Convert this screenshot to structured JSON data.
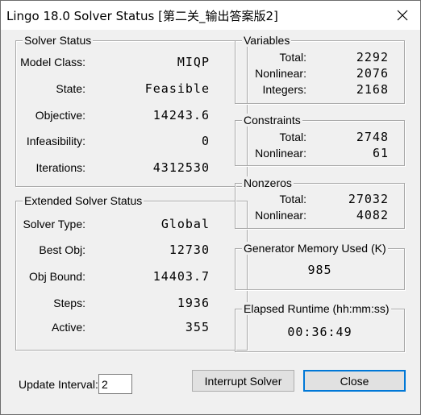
{
  "window": {
    "title": "Lingo 18.0 Solver Status [第二关_输出答案版2]"
  },
  "solver_status": {
    "legend": "Solver Status",
    "rows": [
      {
        "label": "Model Class:",
        "value": "MIQP"
      },
      {
        "label": "State:",
        "value": "Feasible"
      },
      {
        "label": "Objective:",
        "value": "14243.6"
      },
      {
        "label": "Infeasibility:",
        "value": "0"
      },
      {
        "label": "Iterations:",
        "value": "4312530"
      }
    ]
  },
  "extended_status": {
    "legend": "Extended Solver Status",
    "rows": [
      {
        "label": "Solver Type:",
        "value": "Global"
      },
      {
        "label": "Best Obj:",
        "value": "12730"
      },
      {
        "label": "Obj Bound:",
        "value": "14403.7"
      },
      {
        "label": "Steps:",
        "value": "1936"
      },
      {
        "label": "Active:",
        "value": "355"
      }
    ]
  },
  "variables": {
    "legend": "Variables",
    "rows": [
      {
        "label": "Total:",
        "value": "2292"
      },
      {
        "label": "Nonlinear:",
        "value": "2076"
      },
      {
        "label": "Integers:",
        "value": "2168"
      }
    ]
  },
  "constraints": {
    "legend": "Constraints",
    "rows": [
      {
        "label": "Total:",
        "value": "2748"
      },
      {
        "label": "Nonlinear:",
        "value": "61"
      }
    ]
  },
  "nonzeros": {
    "legend": "Nonzeros",
    "rows": [
      {
        "label": "Total:",
        "value": "27032"
      },
      {
        "label": "Nonlinear:",
        "value": "4082"
      }
    ]
  },
  "generator_memory": {
    "legend": "Generator Memory Used (K)",
    "value": "985"
  },
  "elapsed_runtime": {
    "legend": "Elapsed Runtime (hh:mm:ss)",
    "value": "00:36:49"
  },
  "footer": {
    "update_label": "Update Interval:",
    "update_value": "2",
    "interrupt_label": "Interrupt Solver",
    "close_label": "Close"
  }
}
